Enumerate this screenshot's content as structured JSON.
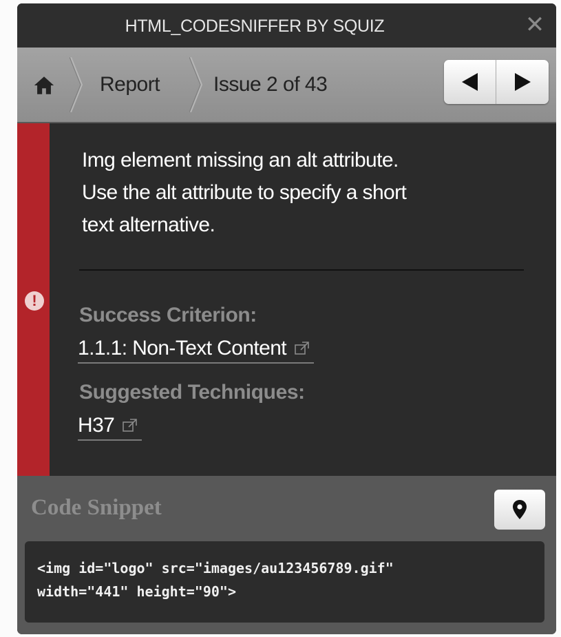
{
  "window": {
    "title": "HTML_CODESNIFFER BY SQUIZ",
    "close_icon": "close-icon"
  },
  "nav": {
    "home_icon": "home-icon",
    "breadcrumb_report": "Report",
    "issue_position": "Issue 2 of 43",
    "prev_icon": "triangle-left-icon",
    "next_icon": "triangle-right-icon"
  },
  "issue": {
    "severity": "error",
    "severity_color": "#b3242a",
    "severity_icon": "exclamation-circle-icon",
    "message_lines": [
      "Img element missing an alt attribute.",
      "Use the alt attribute to specify a short",
      "text alternative."
    ],
    "success_criterion_label": "Success Criterion:",
    "success_criterion_link": "1.1.1: Non-Text Content",
    "techniques_label": "Suggested Techniques:",
    "technique_link": "H37",
    "external_link_icon": "external-link-icon"
  },
  "snippet": {
    "title": "Code Snippet",
    "pin_icon": "map-pin-icon",
    "code_lines": [
      "<img id=\"logo\" src=\"images/au123456789.gif\"",
      "width=\"441\" height=\"90\">"
    ]
  }
}
